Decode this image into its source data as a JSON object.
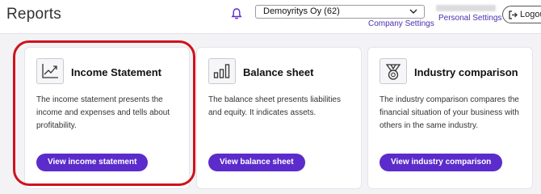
{
  "header": {
    "title": "Reports",
    "notification_icon": "bell-icon",
    "company_select": {
      "value": "Demoyritys Oy (62)"
    },
    "company_settings_label": "Company Settings",
    "personal_settings_label": "Personal Settings",
    "logout_label": "Logout",
    "accent_color": "#5b2ccb"
  },
  "cards": [
    {
      "title": "Income Statement",
      "icon": "line-chart-icon",
      "description": "The income statement presents the income and expenses and tells about profitability.",
      "button_label": "View income statement",
      "highlighted": true
    },
    {
      "title": "Balance sheet",
      "icon": "bar-chart-icon",
      "description": "The balance sheet presents liabilities and equity. It indicates assets.",
      "button_label": "View balance sheet"
    },
    {
      "title": "Industry comparison",
      "icon": "medal-icon",
      "description": "The industry comparison compares the financial situation of your business with others in the same industry.",
      "button_label": "View industry comparison"
    }
  ],
  "colors": {
    "button": "#5b2ccb",
    "link": "#4b2fb0",
    "highlight_ring": "#d0121b"
  }
}
